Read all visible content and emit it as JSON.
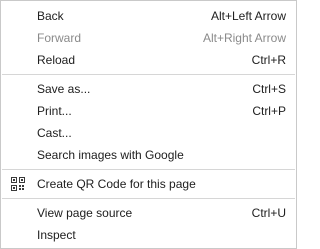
{
  "menu": {
    "items": [
      {
        "label": "Back",
        "shortcut": "Alt+Left Arrow",
        "disabled": false
      },
      {
        "label": "Forward",
        "shortcut": "Alt+Right Arrow",
        "disabled": true
      },
      {
        "label": "Reload",
        "shortcut": "Ctrl+R",
        "disabled": false
      },
      {
        "label": "Save as...",
        "shortcut": "Ctrl+S",
        "disabled": false
      },
      {
        "label": "Print...",
        "shortcut": "Ctrl+P",
        "disabled": false
      },
      {
        "label": "Cast...",
        "shortcut": "",
        "disabled": false
      },
      {
        "label": "Search images with Google",
        "shortcut": "",
        "disabled": false
      },
      {
        "label": "Create QR Code for this page",
        "shortcut": "",
        "icon": "qr-code-icon",
        "disabled": false
      },
      {
        "label": "View page source",
        "shortcut": "Ctrl+U",
        "disabled": false
      },
      {
        "label": "Inspect",
        "shortcut": "",
        "disabled": false
      }
    ]
  },
  "colors": {
    "text": "#202020",
    "disabled_text": "#8a8a8a",
    "separator": "#d6d6d6",
    "border": "#c9c9c9",
    "background": "#ffffff"
  }
}
